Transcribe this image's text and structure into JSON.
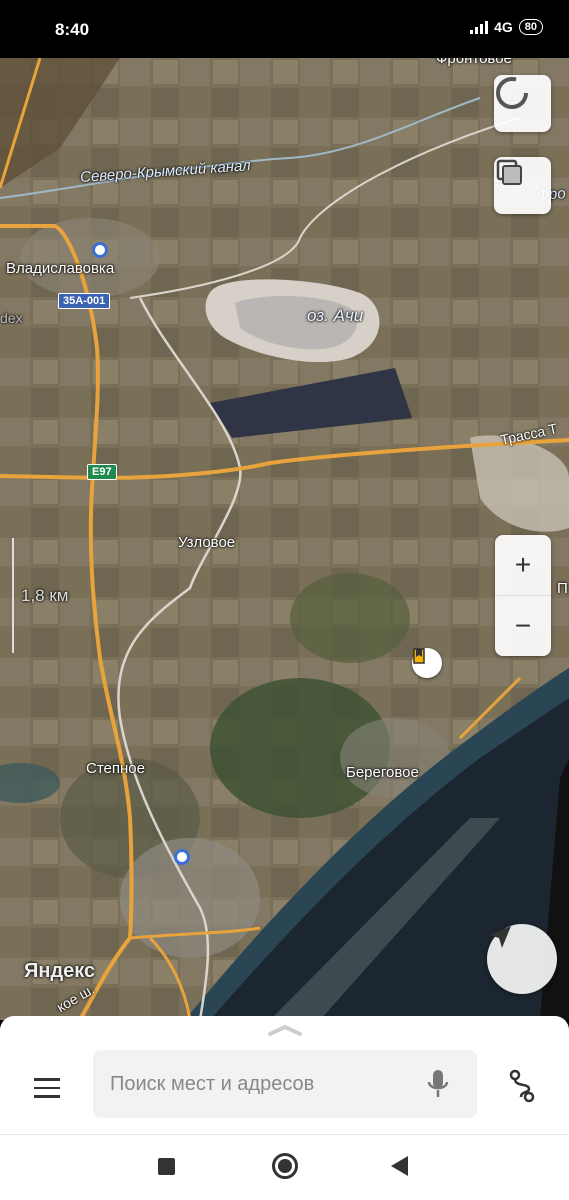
{
  "status": {
    "time": "8:40",
    "network": "4G",
    "battery": "80"
  },
  "map": {
    "labels": {
      "frontovoe": "Фронтовое",
      "canal": "Северо-Крымский канал",
      "canal_cut": "Фро",
      "vladislavovka": "Владиславовка",
      "lake": "оз. Ачи",
      "trassa": "Трасса Т",
      "uzlovoe": "Узловое",
      "stepnoe": "Степное",
      "beregovoe": "Береговое",
      "edge_letter": "П",
      "road_bottom": "кое ш.",
      "dex": "dex",
      "logo": "Яндекс"
    },
    "road_shields": {
      "regional": "35А-001",
      "european": "E97"
    },
    "scale": "1,8 км",
    "zoom_in": "+",
    "zoom_out": "−",
    "colors": {
      "road": "#e8a33c",
      "water": "#2d4a5e",
      "field": "#7a7058"
    }
  },
  "bottom_sheet": {
    "search_placeholder": "Поиск мест и адресов"
  }
}
